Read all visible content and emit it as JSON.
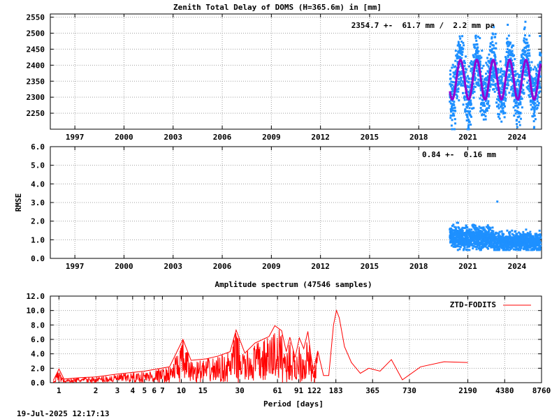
{
  "footer_timestamp": "19-Jul-2025 12:17:13",
  "chart_data": [
    {
      "type": "scatter",
      "title": "Zenith Total Delay of DOMS (H=365.6m) in [mm]",
      "annotation": "2354.7 +-  61.7 mm /  2.2 mm pa",
      "xlim": [
        1995.5,
        2025.5
      ],
      "ylim": [
        2200,
        2560
      ],
      "x_ticks": [
        1997,
        2000,
        2003,
        2006,
        2009,
        2012,
        2015,
        2018,
        2021,
        2024
      ],
      "x_tick_labels": [
        "1997",
        "2000",
        "2003",
        "2006",
        "2009",
        "2012",
        "2015",
        "2018",
        "2021",
        "2024"
      ],
      "y_ticks": [
        2250,
        2300,
        2350,
        2400,
        2450,
        2500,
        2550
      ],
      "y_tick_labels": [
        "2250",
        "2300",
        "2350",
        "2400",
        "2450",
        "2500",
        "2550"
      ],
      "grid": true,
      "series": [
        {
          "color": "#1e90ff",
          "description_points": "daily ZTD, data span",
          "x_start": 2019.9,
          "x_end": 2025.45,
          "mean": 2354.7,
          "amplitude": 61.7,
          "scatter": 45,
          "trend_per_year": 2.2
        },
        {
          "color": "#9400d3",
          "description_points": "seasonal model",
          "x_start": 2019.9,
          "x_end": 2025.45,
          "mean": 2354.7,
          "amplitude": 61.7
        }
      ]
    },
    {
      "type": "scatter",
      "title": "",
      "ylabel": "RMSE",
      "annotation": "0.84 +-  0.16 mm",
      "xlim": [
        1995.5,
        2025.5
      ],
      "ylim": [
        0,
        6
      ],
      "x_ticks": [
        1997,
        2000,
        2003,
        2006,
        2009,
        2012,
        2015,
        2018,
        2021,
        2024
      ],
      "x_tick_labels": [
        "1997",
        "2000",
        "2003",
        "2006",
        "2009",
        "2012",
        "2015",
        "2018",
        "2021",
        "2024"
      ],
      "y_ticks": [
        0,
        1,
        2,
        3,
        4,
        5,
        6
      ],
      "y_tick_labels": [
        "0.0",
        "1.0",
        "2.0",
        "3.0",
        "4.0",
        "5.0",
        "6.0"
      ],
      "grid": true,
      "series": [
        {
          "color": "#1e90ff",
          "segments": [
            {
              "x_start": 2019.9,
              "x_end": 2022.55,
              "mean": 1.1,
              "spread": 0.3
            },
            {
              "x_start": 2022.55,
              "x_end": 2025.45,
              "mean": 0.9,
              "spread": 0.25
            }
          ],
          "outliers": [
            {
              "x": 2022.8,
              "y": 3.05
            }
          ]
        }
      ]
    },
    {
      "type": "line",
      "title": "Amplitude spectrum (47546 samples)",
      "xlabel": "Period [days]",
      "x_scale": "log",
      "xlim": [
        0.85,
        8760
      ],
      "ylim": [
        0,
        12
      ],
      "x_ticks": [
        1,
        2,
        3,
        4,
        5,
        6,
        7,
        10,
        15,
        30,
        61,
        91,
        122,
        183,
        365,
        730,
        2190,
        4380,
        8760
      ],
      "x_tick_labels": [
        "1",
        "2",
        "3",
        "4",
        "5",
        "6",
        "7",
        "10",
        "15",
        "30",
        "61",
        "91",
        "122",
        "183",
        "365",
        "730",
        "2190",
        "4380",
        "8760"
      ],
      "y_ticks": [
        0,
        2,
        4,
        6,
        8,
        10,
        12
      ],
      "y_tick_labels": [
        "0.0",
        "2.0",
        "4.0",
        "6.0",
        "8.0",
        "10.0",
        "12.0"
      ],
      "grid": true,
      "legend": "top-right",
      "series": [
        {
          "name": "ZTD-FODITS",
          "color": "#ff0000",
          "points": [
            [
              0.9,
              0.3
            ],
            [
              1.0,
              1.9
            ],
            [
              1.1,
              0.5
            ],
            [
              1.5,
              0.7
            ],
            [
              2.0,
              0.8
            ],
            [
              3.0,
              1.2
            ],
            [
              5.0,
              1.6
            ],
            [
              8.0,
              2.2
            ],
            [
              10.3,
              6.0
            ],
            [
              12.0,
              3.1
            ],
            [
              16.0,
              3.3
            ],
            [
              20.0,
              3.7
            ],
            [
              25.0,
              4.3
            ],
            [
              28.0,
              7.3
            ],
            [
              33.0,
              4.1
            ],
            [
              40.0,
              5.5
            ],
            [
              52.0,
              6.4
            ],
            [
              58.0,
              7.9
            ],
            [
              66.0,
              7.2
            ],
            [
              72.0,
              4.3
            ],
            [
              77.0,
              6.3
            ],
            [
              85.0,
              3.5
            ],
            [
              92.0,
              6.2
            ],
            [
              100.0,
              4.7
            ],
            [
              108.0,
              7.1
            ],
            [
              115.0,
              3.5
            ],
            [
              120.0,
              1.8
            ],
            [
              130.0,
              4.4
            ],
            [
              145.0,
              1.0
            ],
            [
              160.0,
              1.0
            ],
            [
              175.0,
              8.0
            ],
            [
              185.0,
              10.0
            ],
            [
              195.0,
              9.0
            ],
            [
              215.0,
              5.0
            ],
            [
              245.0,
              2.8
            ],
            [
              290.0,
              1.3
            ],
            [
              340.0,
              2.0
            ],
            [
              420.0,
              1.6
            ],
            [
              520.0,
              3.2
            ],
            [
              640.0,
              0.4
            ],
            [
              900.0,
              2.2
            ],
            [
              1400.0,
              2.9
            ],
            [
              2190.0,
              2.8
            ]
          ]
        }
      ]
    }
  ]
}
